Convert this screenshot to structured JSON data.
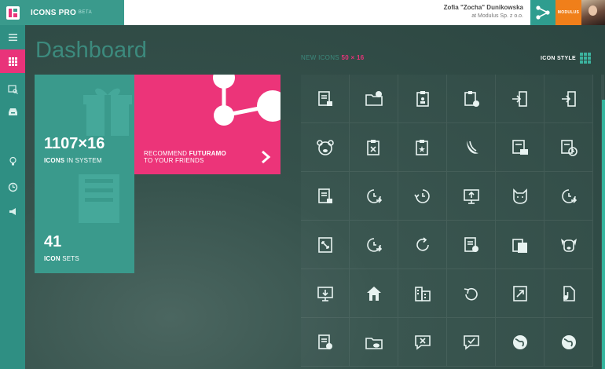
{
  "brand": {
    "name": "ICONS PRO",
    "tag": "BETA"
  },
  "user": {
    "name": "Zofia \"Zocha\" Dunikowska",
    "company": "at Modulus Sp. z o.o.",
    "org_label": "MODULUS"
  },
  "sidebar": {
    "items": [
      {
        "name": "menu",
        "icon": "hamburger-icon"
      },
      {
        "name": "dashboard",
        "icon": "grid-icon",
        "active": true
      },
      {
        "name": "icons",
        "icon": "image-search-icon"
      },
      {
        "name": "inbox",
        "icon": "inbox-icon"
      },
      {
        "name": "ideas",
        "icon": "lightbulb-icon"
      },
      {
        "name": "history",
        "icon": "clock-icon"
      },
      {
        "name": "announce",
        "icon": "megaphone-icon"
      }
    ]
  },
  "main": {
    "title": "Dashboard",
    "new_icons_label": "NEW ICONS",
    "new_icons_count": "50 × 16",
    "icon_style_label": "ICON STYLE"
  },
  "tiles": {
    "system": {
      "number": "1107×16",
      "caption_bold": "ICONS",
      "caption_rest": " IN SYSTEM"
    },
    "recommend": {
      "line1_pre": "RECOMMEND ",
      "line1_bold": "FUTURAMO",
      "line2": "TO YOUR FRIENDS"
    },
    "sets": {
      "number": "41",
      "caption_bold": "ICON",
      "caption_rest": " SETS"
    }
  },
  "colors": {
    "accent": "#e9337a",
    "teal": "#3a9a8c",
    "background": "#2f4a45"
  },
  "icon_grid": [
    "document-lock-icon",
    "folder-alert-icon",
    "clipboard-person-icon",
    "clipboard-add-icon",
    "door-enter-icon",
    "door-exit-icon",
    "bear-icon",
    "clipboard-remove-icon",
    "clipboard-star-icon",
    "banana-icon",
    "document-mail-icon",
    "document-clock-icon",
    "document-lock-icon",
    "clock-forward-icon",
    "clock-back-icon",
    "monitor-upload-icon",
    "cat-icon",
    "clock-forward-icon",
    "resize-icon",
    "clock-forward-icon",
    "refresh-icon",
    "document-alert-icon",
    "documents-icon",
    "dog-icon",
    "monitor-download-icon",
    "home-icon",
    "buildings-icon",
    "undo-icon",
    "expand-icon",
    "file-audio-icon",
    "document-alert-icon",
    "folder-cloud-icon",
    "chat-remove-icon",
    "chat-check-icon",
    "globe-icon",
    "globe-icon"
  ]
}
